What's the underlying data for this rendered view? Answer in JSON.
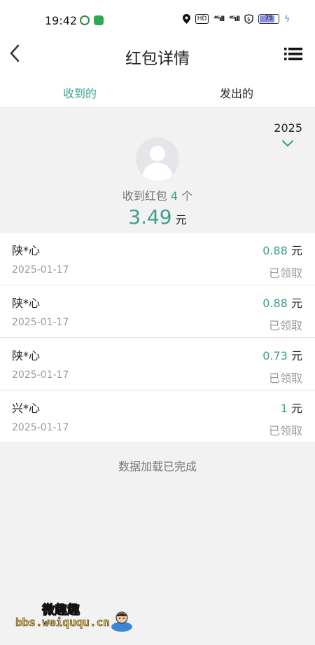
{
  "status_bar": {
    "time": "19:42",
    "hd_label": "HD",
    "signal_1": "⁴ᴳıll",
    "signal_2": "⁴ᴳıll",
    "battery": "75"
  },
  "nav": {
    "title": "红包详情",
    "back_icon": "chevron-left-icon",
    "menu_icon": "list-menu-icon"
  },
  "tabs": [
    {
      "label": "收到的",
      "active": true
    },
    {
      "label": "发出的",
      "active": false
    }
  ],
  "summary": {
    "year": "2025",
    "count_prefix": "收到红包",
    "count": "4",
    "count_suffix": "个",
    "amount": "3.49",
    "amount_unit": "元"
  },
  "records": [
    {
      "name": "陕*心",
      "date": "2025-01-17",
      "amount": "0.88",
      "unit": "元",
      "status": "已领取"
    },
    {
      "name": "陕*心",
      "date": "2025-01-17",
      "amount": "0.88",
      "unit": "元",
      "status": "已领取"
    },
    {
      "name": "陕*心",
      "date": "2025-01-17",
      "amount": "0.73",
      "unit": "元",
      "status": "已领取"
    },
    {
      "name": "兴*心",
      "date": "2025-01-17",
      "amount": "1",
      "unit": "元",
      "status": "已领取"
    }
  ],
  "footer": {
    "loaded_text": "数据加载已完成"
  },
  "watermark": {
    "cn": "微趣趣",
    "url": "bbs.weiququ.cn"
  },
  "colors": {
    "accent": "#3aa08c",
    "background": "#f2f2f2",
    "muted": "#999999"
  }
}
